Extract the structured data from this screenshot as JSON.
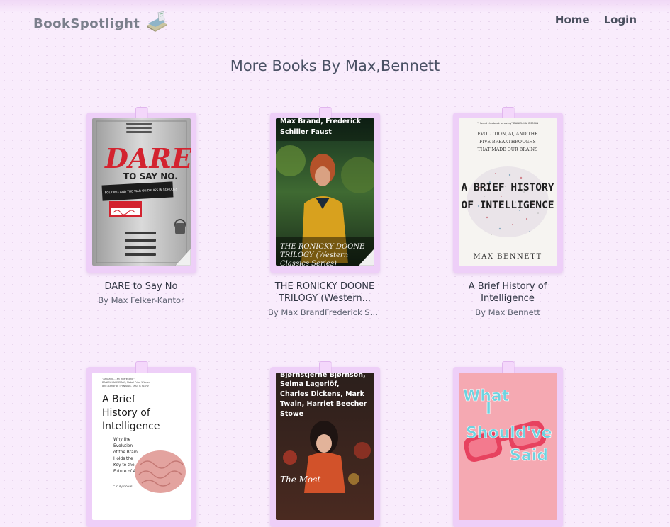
{
  "brand": {
    "name": "BookSpotlight",
    "icon": "book-stack-icon"
  },
  "nav": {
    "home": "Home",
    "login": "Login"
  },
  "page_title": "More Books By Max,Bennett",
  "books": [
    {
      "title": "DARE to Say No",
      "author": "By Max Felker-Kantor",
      "cover": {
        "headline": "DARE",
        "subhead": "TO SAY NO.",
        "tagline": "POLICING AND THE WAR ON DRUGS IN SCHOOLS",
        "accent": "#d3232f"
      }
    },
    {
      "title": "THE RONICKY DOONE TRILOGY (Western...",
      "author": "By Max BrandFrederick Schille...",
      "cover": {
        "top_text": "Max Brand, Frederick Schiller Faust",
        "bottom_text": "THE RONICKY DOONE TRILOGY (Western Classics Series)"
      }
    },
    {
      "title": "A Brief History of Intelligence",
      "author": "By Max Bennett",
      "cover": {
        "blurb": "\"I found this book amazing\" DANIEL KAHNEMAN",
        "subtitle": "EVOLUTION, AI, AND THE FIVE BREAKTHROUGHS THAT MADE OUR BRAINS",
        "headline": "A BRIEF HISTORY OF INTELLIGENCE",
        "author": "MAX BENNETT"
      }
    },
    {
      "title": "",
      "author": "",
      "cover": {
        "blurb": "\"Amazing... an interesting\" DANIEL KAHNEMAN, Nobel Prize Winner and author of THINKING, FAST & SLOW",
        "headline": "A Brief History of Intelligence",
        "subtitle": "Why the Evolution of the Brain Holds the Key to the Future of AI",
        "quote": "\"Truly novel..."
      }
    },
    {
      "title": "",
      "author": "",
      "cover": {
        "top_text": "Bjørnstjerne Bjørnson, Selma Lagerlöf, Charles Dickens, Mark Twain, Harriet Beecher Stowe",
        "bottom_text": "The Most"
      }
    },
    {
      "title": "",
      "author": "",
      "cover": {
        "headline": "What I Should've Said"
      }
    }
  ]
}
